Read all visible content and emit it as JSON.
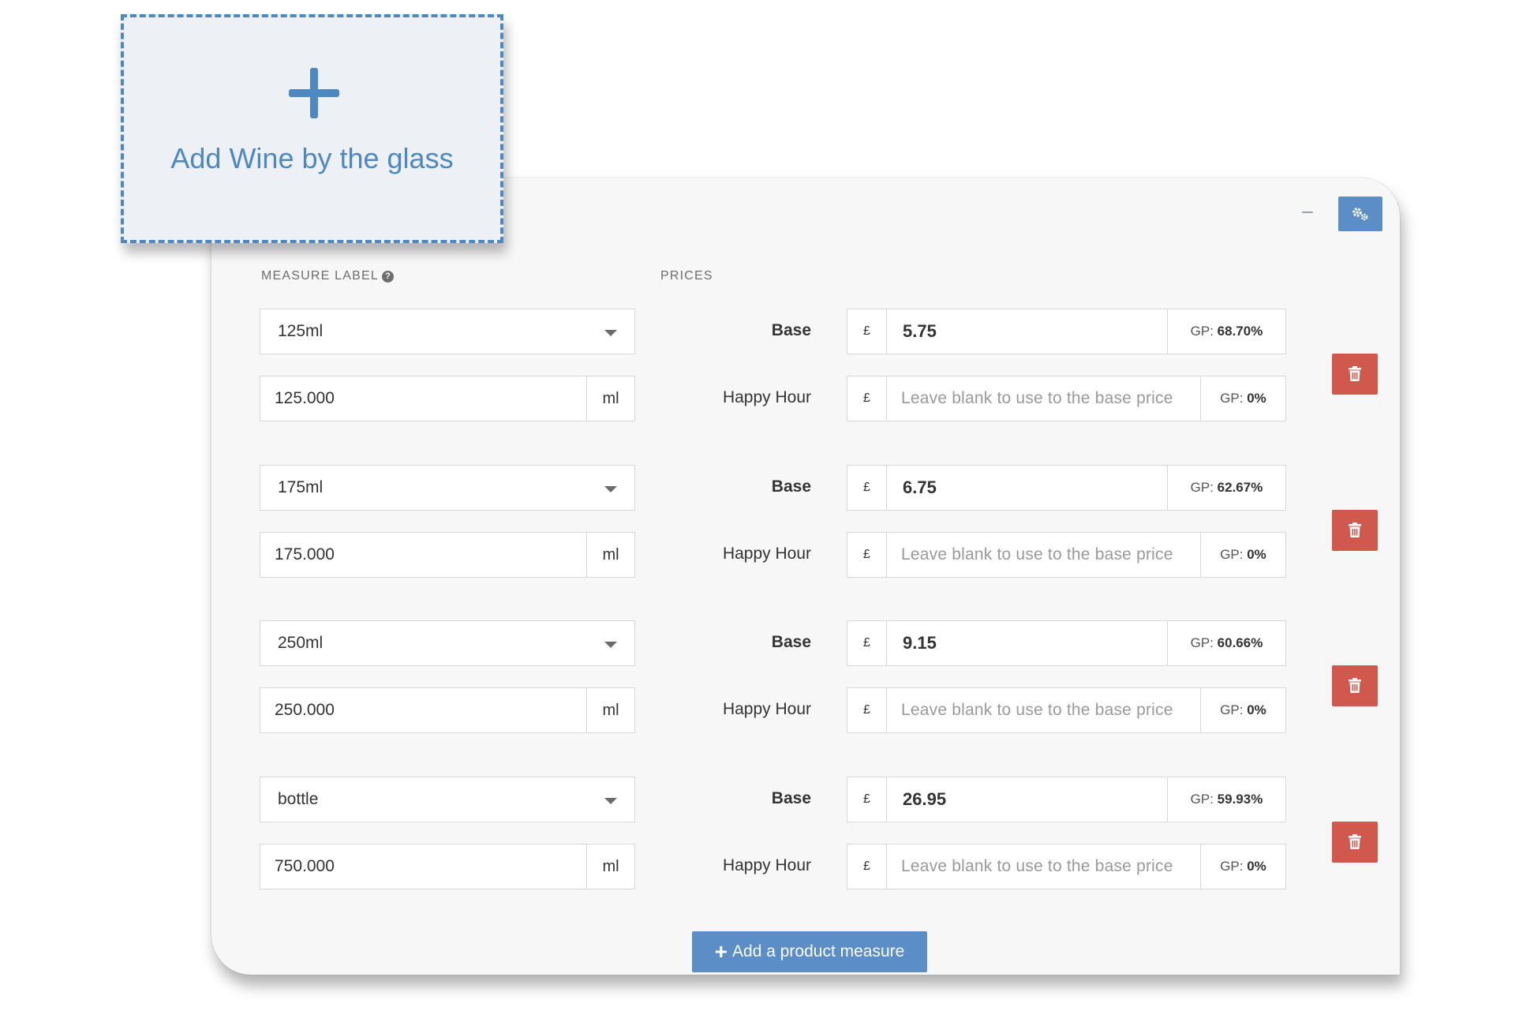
{
  "add_card": {
    "label": "Add Wine by the glass"
  },
  "panel": {
    "headers": {
      "measure_label": "MEASURE LABEL",
      "help": "?",
      "prices": "PRICES"
    },
    "measures": [
      {
        "label": "125ml",
        "amount": "125.000",
        "unit": "ml",
        "currency": "£",
        "base_label": "Base",
        "base_price": "5.75",
        "base_gp_prefix": "GP:",
        "base_gp": "68.70%",
        "hh_label": "Happy Hour",
        "hh_placeholder": "Leave blank to use to the base price",
        "hh_gp_prefix": "GP:",
        "hh_gp": "0%"
      },
      {
        "label": "175ml",
        "amount": "175.000",
        "unit": "ml",
        "currency": "£",
        "base_label": "Base",
        "base_price": "6.75",
        "base_gp_prefix": "GP:",
        "base_gp": "62.67%",
        "hh_label": "Happy Hour",
        "hh_placeholder": "Leave blank to use to the base price",
        "hh_gp_prefix": "GP:",
        "hh_gp": "0%"
      },
      {
        "label": "250ml",
        "amount": "250.000",
        "unit": "ml",
        "currency": "£",
        "base_label": "Base",
        "base_price": "9.15",
        "base_gp_prefix": "GP:",
        "base_gp": "60.66%",
        "hh_label": "Happy Hour",
        "hh_placeholder": "Leave blank to use to the base price",
        "hh_gp_prefix": "GP:",
        "hh_gp": "0%"
      },
      {
        "label": "bottle",
        "amount": "750.000",
        "unit": "ml",
        "currency": "£",
        "base_label": "Base",
        "base_price": "26.95",
        "base_gp_prefix": "GP:",
        "base_gp": "59.93%",
        "hh_label": "Happy Hour",
        "hh_placeholder": "Leave blank to use to the base price",
        "hh_gp_prefix": "GP:",
        "hh_gp": "0%"
      }
    ],
    "add_measure_plus": "+",
    "add_measure_label": "Add a product measure",
    "icons": {
      "settings": "gears-icon",
      "delete": "trash-icon",
      "minimize": "minimize-icon"
    },
    "colors": {
      "primary": "#5b8ec7",
      "danger": "#d0584d",
      "card_border": "#4d88c2"
    }
  }
}
